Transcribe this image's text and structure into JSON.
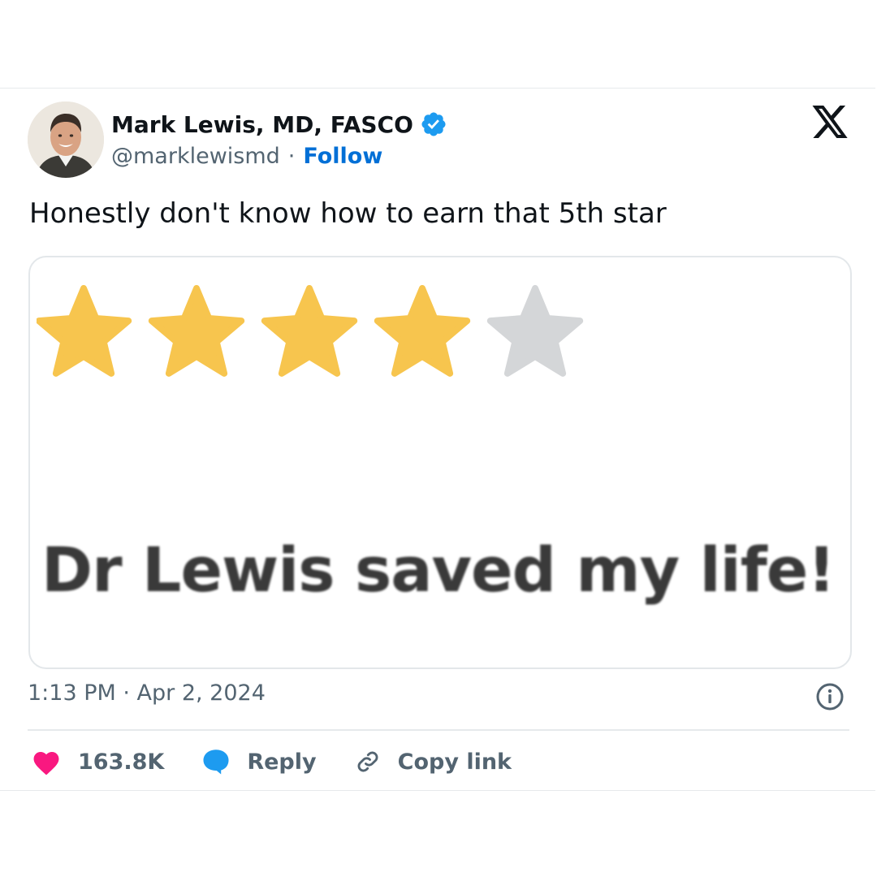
{
  "tweet": {
    "author_name": "Mark Lewis, MD, FASCO",
    "handle": "@marklewismd",
    "separator": "·",
    "follow_label": "Follow",
    "text": "Honestly don't know how to earn that 5th star",
    "timestamp": "1:13 PM · Apr 2, 2024"
  },
  "media": {
    "rating": {
      "filled": 4,
      "total": 5
    },
    "review_text": "Dr Lewis saved my life!"
  },
  "actions": {
    "likes_count": "163.8K",
    "reply_label": "Reply",
    "copy_link_label": "Copy link"
  },
  "icons": {
    "verified": "verified-badge-icon",
    "x_logo": "x-logo-icon",
    "info": "info-icon",
    "heart": "heart-icon",
    "reply": "speech-bubble-icon",
    "link": "link-icon"
  },
  "colors": {
    "star_filled": "#f7c54e",
    "star_empty": "#d4d6d8",
    "verified": "#1d9bf0",
    "follow": "#006fd6",
    "heart": "#f91880",
    "reply": "#1d9bf0",
    "muted": "#536471"
  }
}
